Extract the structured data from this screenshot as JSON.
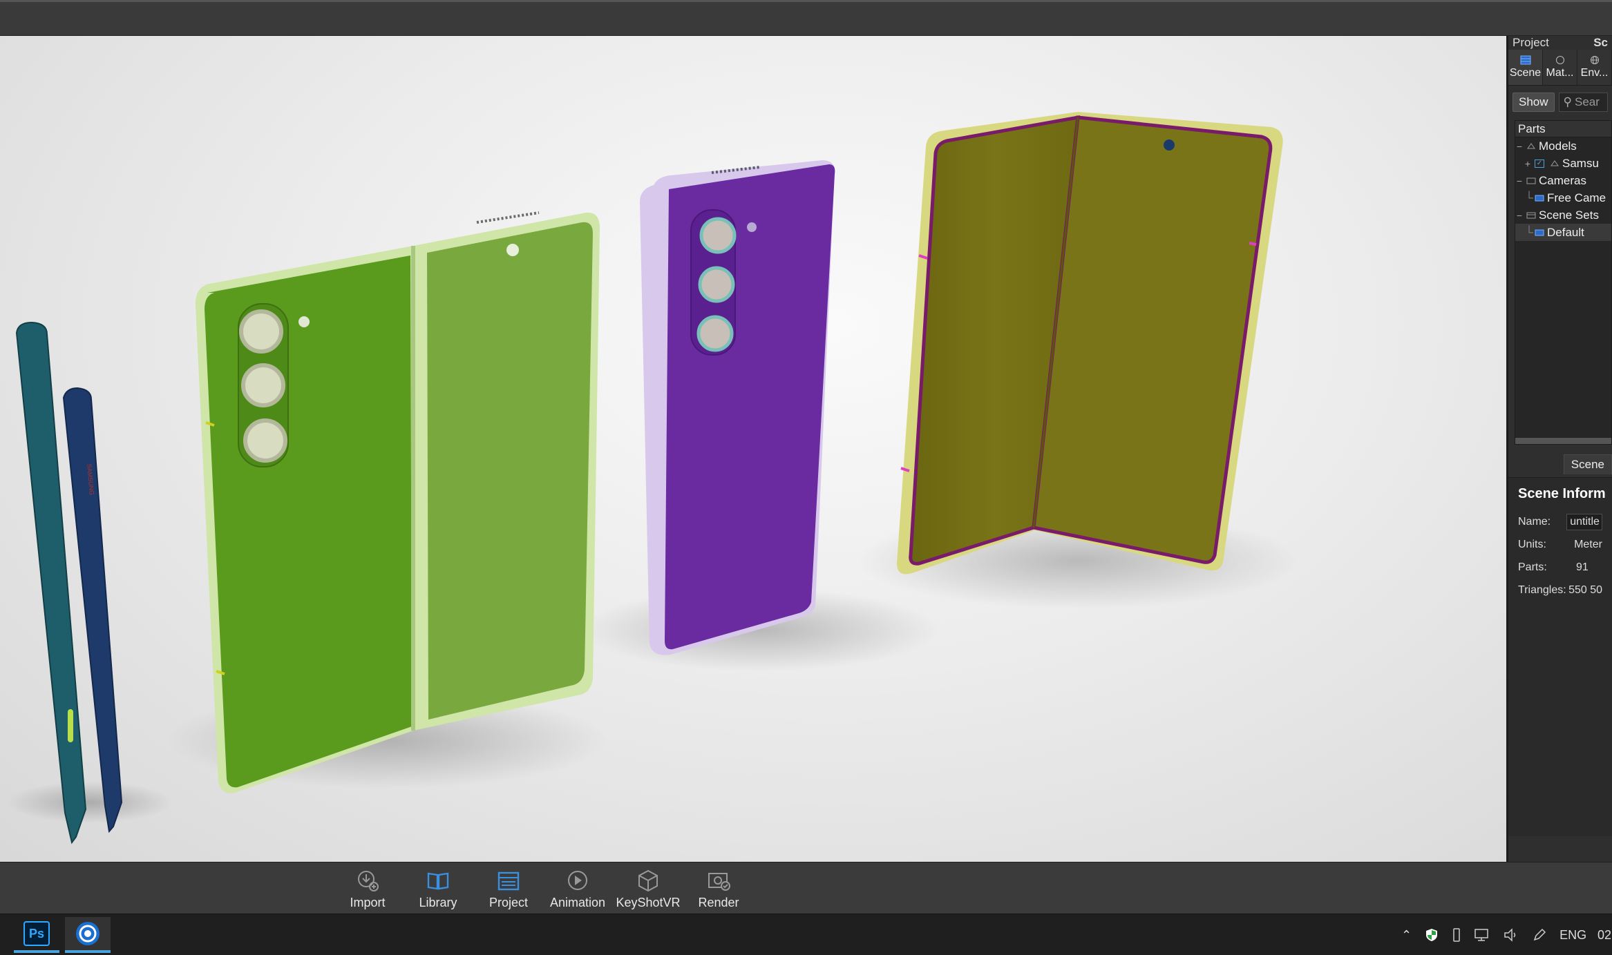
{
  "right_panel": {
    "header_left": "Project",
    "header_right": "Sc",
    "tabs": [
      {
        "label": "Scene",
        "icon": "scene-icon"
      },
      {
        "label": "Mat...",
        "icon": "material-icon"
      },
      {
        "label": "Env...",
        "icon": "environment-icon"
      }
    ],
    "show_button": "Show",
    "search_placeholder": "Sear",
    "tree_title": "Parts",
    "tree": [
      {
        "label": "Models",
        "expander": "−",
        "icon": "models-icon"
      },
      {
        "label": "Samsu",
        "expander": "+",
        "icon": "model-icon",
        "checked": true
      },
      {
        "label": "Cameras",
        "expander": "−",
        "icon": "cameras-icon"
      },
      {
        "label": "Free Came",
        "icon": "camera-icon"
      },
      {
        "label": "Scene Sets",
        "expander": "−",
        "icon": "scene-sets-icon"
      },
      {
        "label": "Default",
        "icon": "scene-set-icon"
      }
    ],
    "subtab": "Scene",
    "scene_info": {
      "title": "Scene Inform",
      "rows": [
        {
          "label": "Name:",
          "value": "untitle"
        },
        {
          "label": "Units:",
          "value": "Meter"
        },
        {
          "label": "Parts:",
          "value": "91"
        },
        {
          "label": "Triangles:",
          "value": "550 50"
        }
      ]
    }
  },
  "ribbon": {
    "buttons": [
      {
        "label": "Import",
        "icon": "import-icon"
      },
      {
        "label": "Library",
        "icon": "library-icon"
      },
      {
        "label": "Project",
        "icon": "project-icon"
      },
      {
        "label": "Animation",
        "icon": "animation-icon"
      },
      {
        "label": "KeyShotVR",
        "icon": "keyshotvr-icon"
      },
      {
        "label": "Render",
        "icon": "render-icon"
      }
    ]
  },
  "taskbar": {
    "apps": [
      {
        "label": "Ps",
        "icon": "photoshop-icon"
      },
      {
        "label": "",
        "icon": "keyshot-icon",
        "active": true
      }
    ],
    "language": "ENG",
    "clock": "02"
  },
  "viewport": {
    "colors": {
      "green_phone": "#5a9a1c",
      "green_screen": "#78a83e",
      "purple_phone": "#6a2aa0",
      "olive_phone": "#6e6a10",
      "pen_teal": "#1e5e6a",
      "pen_navy": "#1e3a6a"
    }
  }
}
